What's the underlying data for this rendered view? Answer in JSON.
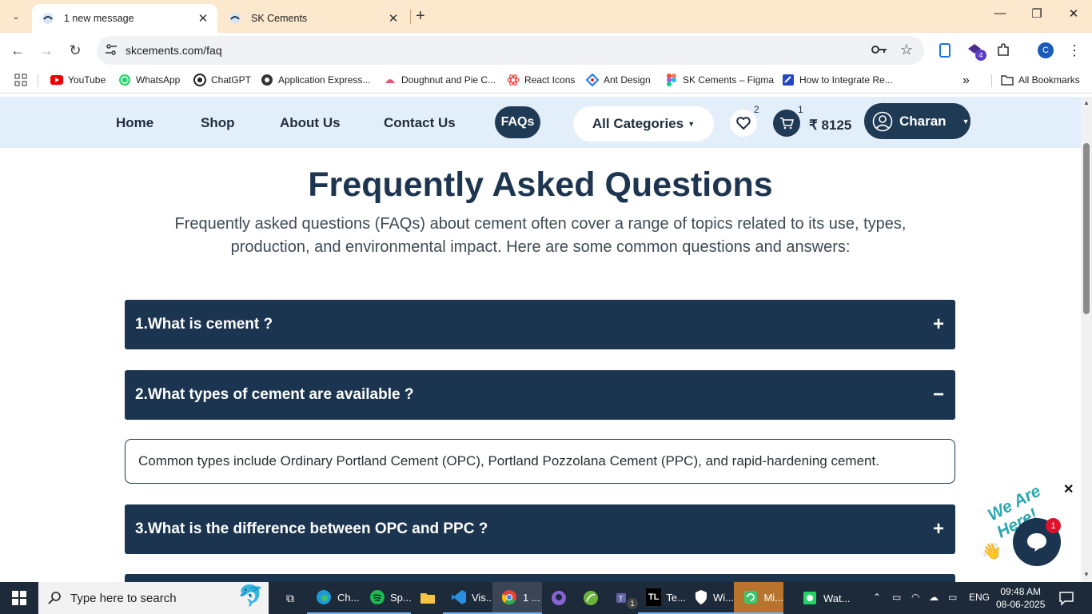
{
  "browser": {
    "tabs": [
      {
        "title": "1 new message",
        "active": true
      },
      {
        "title": "SK Cements",
        "active": false
      }
    ],
    "url": "skcements.com/faq",
    "profile_initial": "C",
    "extension_badge": "4",
    "bookmarks": [
      {
        "label": "YouTube",
        "icon": "youtube-icon"
      },
      {
        "label": "WhatsApp",
        "icon": "whatsapp-icon"
      },
      {
        "label": "ChatGPT",
        "icon": "chatgpt-icon"
      },
      {
        "label": "Application Express...",
        "icon": "apex-icon"
      },
      {
        "label": "Doughnut and Pie C...",
        "icon": "chart-icon"
      },
      {
        "label": "React Icons",
        "icon": "react-icon"
      },
      {
        "label": "Ant Design",
        "icon": "antdesign-icon"
      },
      {
        "label": "SK Cements – Figma",
        "icon": "figma-icon"
      },
      {
        "label": "How to Integrate Re...",
        "icon": "link-icon"
      }
    ],
    "all_bookmarks": "All Bookmarks"
  },
  "site": {
    "nav": {
      "home": "Home",
      "shop": "Shop",
      "about": "About Us",
      "contact": "Contact Us",
      "faqs": "FAQs",
      "categories": "All Categories",
      "wishlist_count": "2",
      "cart_count": "1",
      "cart_total": "₹ 8125",
      "user": "Charan"
    },
    "faq": {
      "title": "Frequently Asked Questions",
      "intro": "Frequently asked questions (FAQs) about cement often cover a range of topics related to its use, types, production, and environmental impact. Here are some common questions and answers:",
      "items": [
        {
          "question": "1.What is cement ?",
          "toggle": "+"
        },
        {
          "question": "2.What types of cement are available ?",
          "toggle": "−",
          "answer": "Common types include Ordinary Portland Cement (OPC), Portland Pozzolana Cement (PPC), and rapid-hardening cement."
        },
        {
          "question": "3.What is the difference between OPC and PPC ?",
          "toggle": "+"
        }
      ]
    },
    "chat": {
      "tagline": "We Are Here!",
      "unread": "1",
      "accent": "#2aa7b0"
    }
  },
  "taskbar": {
    "search_placeholder": "Type here to search",
    "apps": [
      {
        "label": "Ch...",
        "icon": "edge-icon"
      },
      {
        "label": "Sp...",
        "icon": "spotify-icon"
      },
      {
        "label": "",
        "icon": "file-explorer-icon"
      },
      {
        "label": "Vis...",
        "icon": "vscode-icon"
      },
      {
        "label": "1 ...",
        "icon": "chrome-icon"
      },
      {
        "label": "",
        "icon": "github-icon"
      },
      {
        "label": "",
        "icon": "spring-icon"
      },
      {
        "label": "",
        "icon": "teams-icon"
      },
      {
        "label": "Te...",
        "icon": "tlauncher-icon"
      },
      {
        "label": "Wi...",
        "icon": "security-icon"
      },
      {
        "label": "Mi...",
        "icon": "app-icon"
      },
      {
        "label": "Wat...",
        "icon": "whatsapp-icon"
      }
    ],
    "teams_badge": "1",
    "language": "ENG",
    "time": "09:48 AM",
    "date": "08-06-2025"
  },
  "colors": {
    "navy": "#1b3550",
    "nav_bg": "#e3eefb",
    "tab_strip": "#fce8cc",
    "badge_red": "#e0112b"
  }
}
